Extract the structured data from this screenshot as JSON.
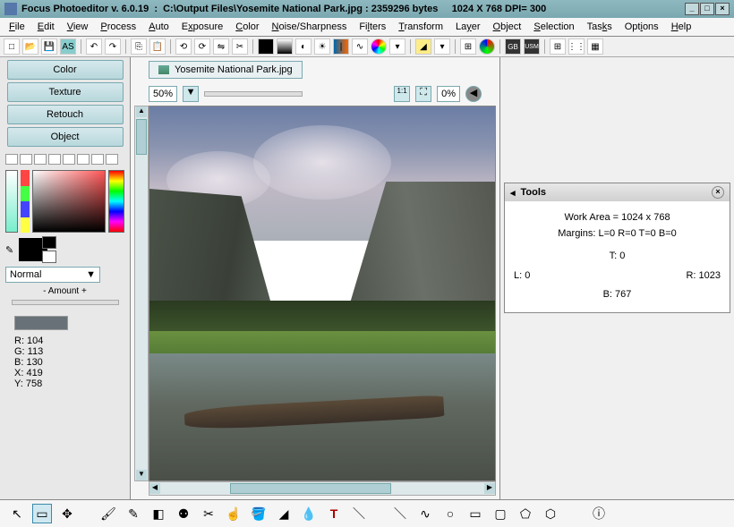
{
  "titlebar": {
    "app": "Focus Photoeditor v. 6.0.19",
    "path": "C:\\Output Files\\Yosemite National Park.jpg",
    "bytes": "2359296 bytes",
    "dims": "1024 X 768 DPI= 300"
  },
  "menu": [
    "File",
    "Edit",
    "View",
    "Process",
    "Auto",
    "Exposure",
    "Color",
    "Noise/Sharpness",
    "Filters",
    "Transform",
    "Layer",
    "Object",
    "Selection",
    "Tasks",
    "Options",
    "Help"
  ],
  "sidebar": {
    "tabs": [
      "Color",
      "Texture",
      "Retouch",
      "Object"
    ],
    "blend_mode": "Normal",
    "amount_label": "- Amount +",
    "info": {
      "r": "R: 104",
      "g": "G: 113",
      "b": "B: 130",
      "x": "X: 419",
      "y": "Y: 758"
    }
  },
  "document": {
    "tab_name": "Yosemite National Park.jpg",
    "zoom": "50%",
    "zoom2": "0%"
  },
  "tools_panel": {
    "title": "Tools",
    "work_area": "Work Area = 1024 x 768",
    "margins": "Margins: L=0 R=0 T=0 B=0",
    "t": "T: 0",
    "l": "L: 0",
    "r": "R: 1023",
    "b": "B: 767"
  }
}
